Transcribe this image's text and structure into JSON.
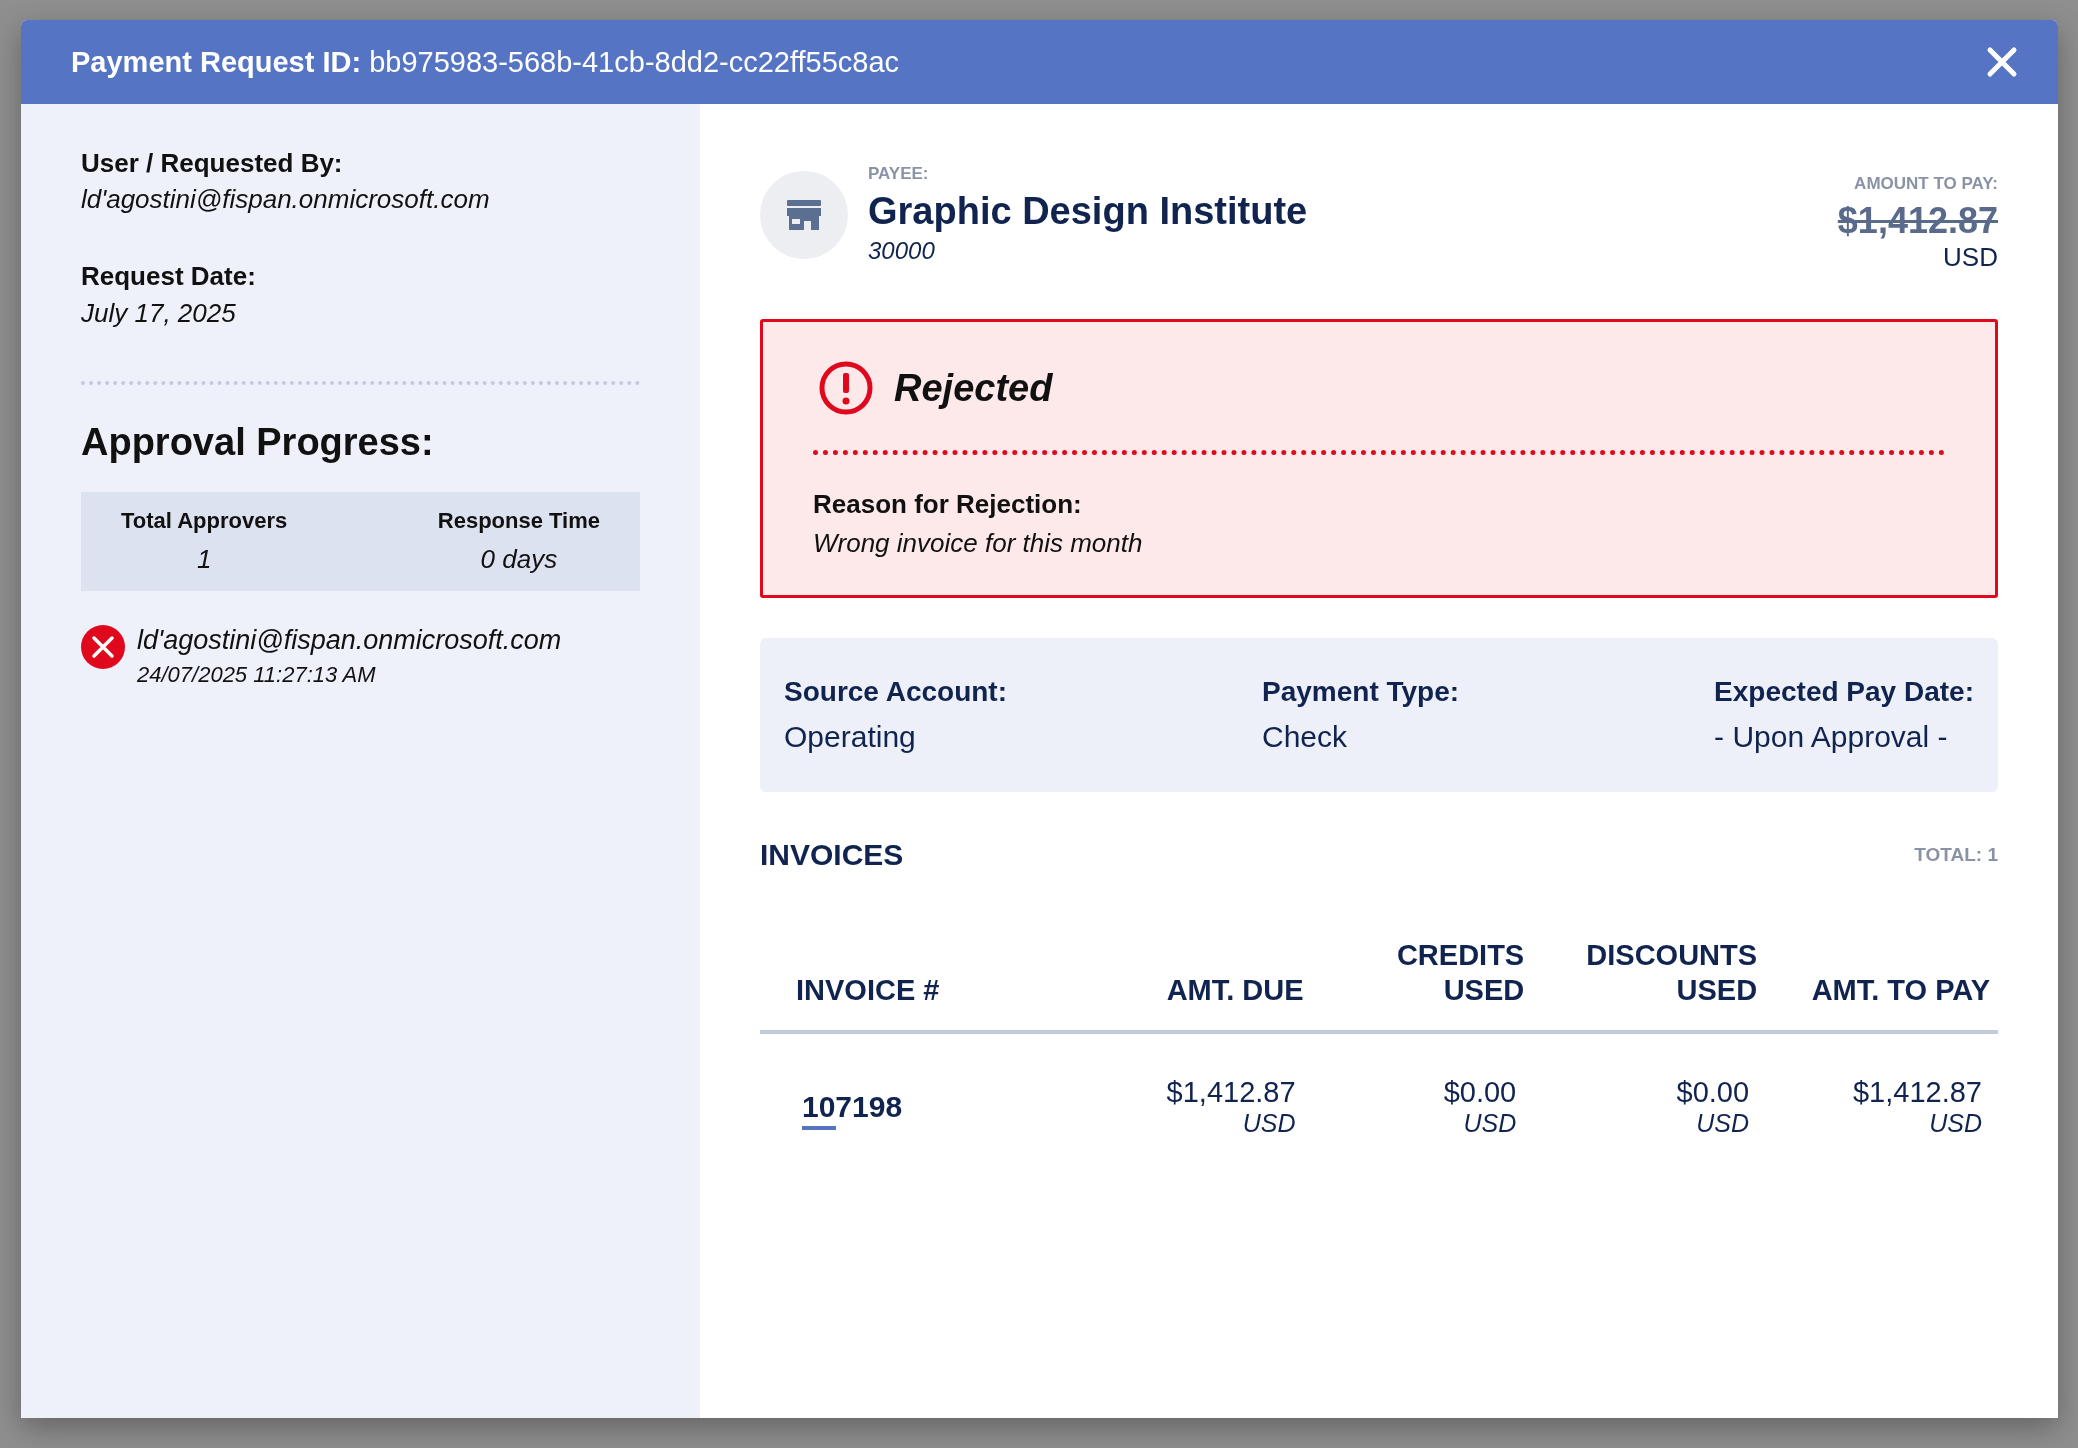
{
  "header": {
    "label": "Payment Request ID:",
    "value": "bb975983-568b-41cb-8dd2-cc22ff55c8ac"
  },
  "requester": {
    "label": "User / Requested By:",
    "value": "ld'agostini@fispan.onmicrosoft.com"
  },
  "request_date": {
    "label": "Request Date:",
    "value": "July 17, 2025"
  },
  "approval": {
    "title": "Approval Progress:",
    "stats": [
      {
        "label": "Total Approvers",
        "value": "1"
      },
      {
        "label": "Response Time",
        "value": "0 days"
      }
    ],
    "approvers": [
      {
        "email": "ld'agostini@fispan.onmicrosoft.com",
        "timestamp": "24/07/2025 11:27:13 AM",
        "rejected": true
      }
    ]
  },
  "payee": {
    "label": "PAYEE:",
    "name": "Graphic Design Institute",
    "number": "30000"
  },
  "amount": {
    "label": "AMOUNT TO PAY:",
    "value": "$1,412.87",
    "currency": "USD",
    "struck": true
  },
  "status": {
    "kind": "rejected",
    "title": "Rejected",
    "reason_label": "Reason for Rejection:",
    "reason": "Wrong invoice for this month"
  },
  "details": [
    {
      "label": "Source Account:",
      "value": "Operating"
    },
    {
      "label": "Payment Type:",
      "value": "Check"
    },
    {
      "label": "Expected Pay Date:",
      "value": "- Upon Approval -"
    }
  ],
  "invoices": {
    "title": "INVOICES",
    "total": "TOTAL: 1",
    "columns": [
      "INVOICE #",
      "AMT. DUE",
      "CREDITS USED",
      "DISCOUNTS USED",
      "AMT. TO PAY"
    ],
    "rows": [
      {
        "cells": [
          {
            "kind": "link",
            "text": "107198"
          },
          {
            "kind": "amount",
            "text": "$1,412.87",
            "currency": "USD"
          },
          {
            "kind": "amount",
            "text": "$0.00",
            "currency": "USD"
          },
          {
            "kind": "amount",
            "text": "$0.00",
            "currency": "USD"
          },
          {
            "kind": "amount",
            "text": "$1,412.87",
            "currency": "USD"
          }
        ]
      }
    ]
  }
}
